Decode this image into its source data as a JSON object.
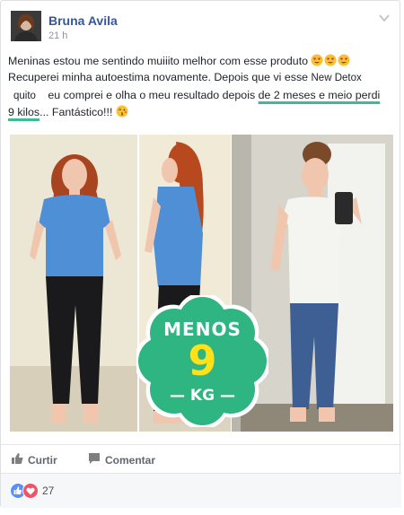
{
  "post": {
    "author": "Bruna Avila",
    "time": "21 h",
    "text": {
      "l1": "Meninas estou me sentindo muiiito melhor com esse produto",
      "l2": "Recuperei minha autoestima novamente. Depois que vi esse",
      "product_line1": "New Detox",
      "product_line2": "quito",
      "l3a": "eu comprei e olha o meu resultado depois",
      "l3b": "de 2 meses e meio perdi",
      "l4a": "9 kilos",
      "l4b": "... Fantástico!!!"
    },
    "emojis": [
      "heart-eyes-emoji",
      "heart-eyes-emoji",
      "heart-eyes-emoji",
      "kiss-emoji"
    ]
  },
  "photo_badge": {
    "top": "MENOS",
    "number": "9",
    "unit": "— KG —",
    "badge_color": "#2fb581",
    "number_color": "#ffe11a"
  },
  "actions": {
    "like_label": "Curtir",
    "comment_label": "Comentar"
  },
  "reactions": {
    "count": "27",
    "types": [
      "like-reaction-icon",
      "love-reaction-icon"
    ]
  },
  "colors": {
    "author": "#365899",
    "highlight": "#3dbb98",
    "muted": "#90949c"
  }
}
